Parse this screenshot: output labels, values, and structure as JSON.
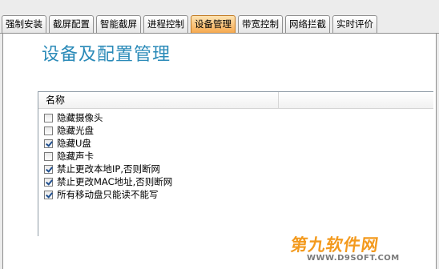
{
  "tabs": [
    {
      "label": "强制安装",
      "active": false
    },
    {
      "label": "截屏配置",
      "active": false
    },
    {
      "label": "智能截屏",
      "active": false
    },
    {
      "label": "进程控制",
      "active": false
    },
    {
      "label": "设备管理",
      "active": true
    },
    {
      "label": "带宽控制",
      "active": false
    },
    {
      "label": "网络拦截",
      "active": false
    },
    {
      "label": "实时评价",
      "active": false
    }
  ],
  "page": {
    "title": "设备及配置管理"
  },
  "list": {
    "column_name": "名称",
    "items": [
      {
        "label": "隐藏摄像头",
        "checked": false
      },
      {
        "label": "隐藏光盘",
        "checked": false
      },
      {
        "label": "隐藏U盘",
        "checked": true
      },
      {
        "label": "隐藏声卡",
        "checked": false
      },
      {
        "label": "禁止更改本地IP,否则断网",
        "checked": true
      },
      {
        "label": "禁止更改MAC地址,否则断网",
        "checked": true
      },
      {
        "label": "所有移动盘只能读不能写",
        "checked": true
      }
    ]
  },
  "watermark": {
    "main": "第九软件网",
    "sub": "WWW.D9SOFT.COM"
  },
  "colors": {
    "accent_title": "#2a8ab8",
    "active_tab": "#f6a94f",
    "watermark": "#f39a1e"
  }
}
